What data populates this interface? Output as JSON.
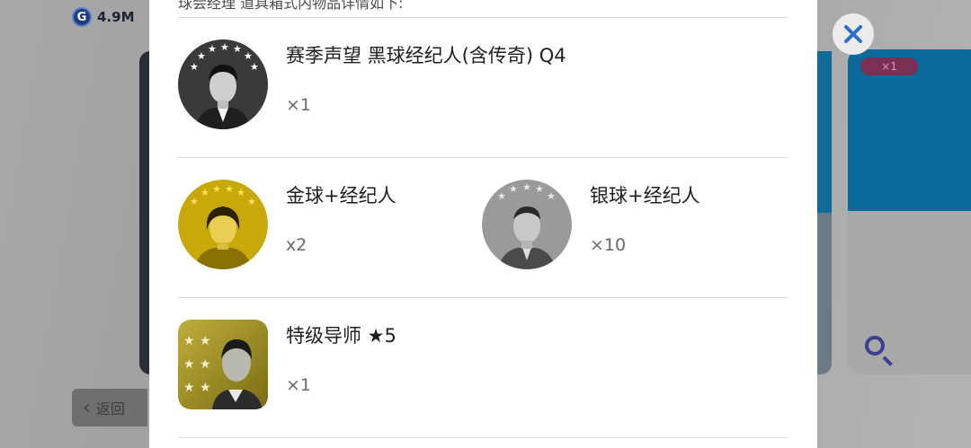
{
  "top_bar": {
    "currency_icon": "G",
    "currency_value": "4.9M"
  },
  "background": {
    "badge_label": "×1",
    "back_label": "返回",
    "accent_colors": {
      "blue": "#0b6a9c",
      "badge": "#7b2f53"
    }
  },
  "modal": {
    "header_text": "球会经理 道具箱式内物品详情如下:",
    "items": [
      {
        "name": "赛季声望 黑球经纪人(含传奇) Q4",
        "qty": "×1",
        "icon": "black-ball-agent-icon"
      },
      {
        "name": "金球+经纪人",
        "qty": "x2",
        "icon": "gold-ball-agent-icon"
      },
      {
        "name": "银球+经纪人",
        "qty": "×10",
        "icon": "silver-ball-agent-icon"
      },
      {
        "name": "特级导师 ★5",
        "qty": "×1",
        "icon": "premium-coach-icon"
      }
    ]
  }
}
